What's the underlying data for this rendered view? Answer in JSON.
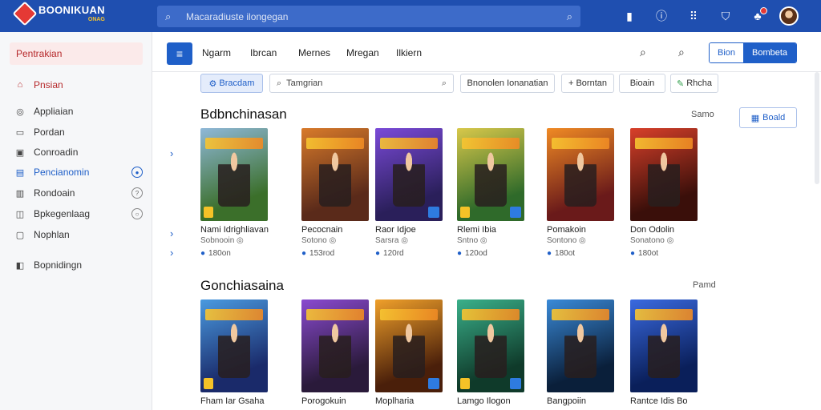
{
  "app": {
    "logo_title": "BOONIKUAN",
    "logo_sub": "ONAG"
  },
  "search": {
    "placeholder": "Macaradiuste ilongegan"
  },
  "sidebar": {
    "active_label": "Pentrakian",
    "items": [
      {
        "label": "Pnsian",
        "icon": "⌂"
      },
      {
        "label": "Appliaian",
        "icon": "◎"
      },
      {
        "label": "Pordan",
        "icon": "▭"
      },
      {
        "label": "Conroadin",
        "icon": "▣"
      },
      {
        "label": "Pencianomin",
        "icon": "▤",
        "badge": "●"
      },
      {
        "label": "Rondoain",
        "icon": "▥",
        "badge": "?"
      },
      {
        "label": "Bpkegenlaag",
        "icon": "◫",
        "badge": "○"
      },
      {
        "label": "Nophlan",
        "icon": "▢"
      },
      {
        "label": "Bopnidingn",
        "icon": "◧"
      }
    ]
  },
  "tabs": [
    "Ngarm",
    "Ibrcan",
    "Mernes",
    "Mregan",
    "Ilkiern"
  ],
  "toggle": {
    "left_label": "Bion",
    "right_label": "Bombeta"
  },
  "filters": {
    "primary_chip": "Bracdam",
    "search_placeholder": "Tamgrian",
    "chips": [
      "Bnonolen Ionanatian",
      "Borntan",
      "Bioain",
      "Rhcha"
    ]
  },
  "section1": {
    "title": "Bdbnchinasan",
    "link": "Samo",
    "button": "Boald",
    "cards": [
      {
        "name": "Nami Idrighliavan",
        "meta": "Sobnooin",
        "rating": "180on",
        "c1": "#3b6f2a",
        "c2": "#8fb8d8"
      },
      {
        "name": "Pecocnain",
        "meta": "Sotono",
        "rating": "153rod",
        "c1": "#5a2a1a",
        "c2": "#d87a2a"
      },
      {
        "name": "Raor Idjoe",
        "meta": "Sarsra",
        "rating": "120rd",
        "c1": "#2a1f5a",
        "c2": "#7a4ad8"
      },
      {
        "name": "Rlemi Ibia",
        "meta": "Sntno",
        "rating": "120od",
        "c1": "#2f6a2a",
        "c2": "#d8c84a"
      },
      {
        "name": "Pomakoin",
        "meta": "Sontono",
        "rating": "180ot",
        "c1": "#6a1a1a",
        "c2": "#f08a24"
      },
      {
        "name": "Don Odolin",
        "meta": "Sonatono",
        "rating": "180ot",
        "c1": "#3a0f0a",
        "c2": "#d8402a"
      }
    ]
  },
  "section2": {
    "title": "Gonchiasaina",
    "link": "Pamd",
    "cards": [
      {
        "name": "Fham Iar Gsaha",
        "c1": "#1a2a6a",
        "c2": "#4a9ae0"
      },
      {
        "name": "Porogokuin",
        "c1": "#2a1a3a",
        "c2": "#8a4ad0"
      },
      {
        "name": "Moplharia",
        "c1": "#4a1f0a",
        "c2": "#f0a02a"
      },
      {
        "name": "Lamgo Ilogon",
        "c1": "#0f3a2a",
        "c2": "#3ab08a"
      },
      {
        "name": "Bangpoiin",
        "c1": "#0a1f3a",
        "c2": "#3a8ad8"
      },
      {
        "name": "Rantce Idis Bo",
        "c1": "#0a1f5a",
        "c2": "#3a6ae0"
      }
    ]
  },
  "colors": {
    "brand": "#1f4fb0",
    "accent": "#1f5fc8",
    "danger": "#e53935"
  }
}
